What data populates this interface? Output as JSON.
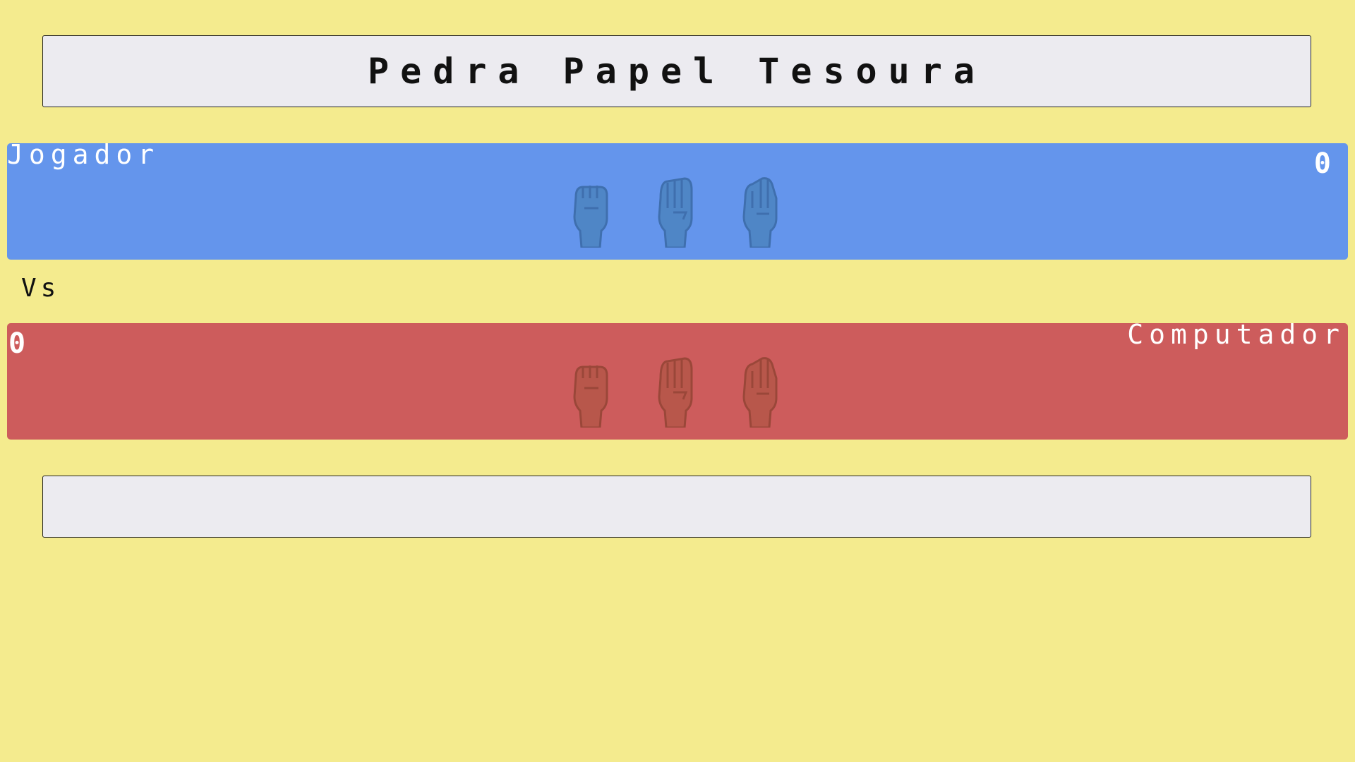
{
  "header": {
    "title": "Pedra Papel Tesoura"
  },
  "player": {
    "label": "Jogador",
    "score": "0",
    "color": "#6495ec",
    "choices": [
      {
        "icon": "rock-hand-icon"
      },
      {
        "icon": "paper-hand-icon"
      },
      {
        "icon": "scissors-hand-icon"
      }
    ]
  },
  "versus": {
    "label": "Vs"
  },
  "computer": {
    "label": "Computador",
    "score": "0",
    "color": "#cd5c5c",
    "choices": [
      {
        "icon": "rock-hand-icon"
      },
      {
        "icon": "paper-hand-icon"
      },
      {
        "icon": "scissors-hand-icon"
      }
    ]
  },
  "result": {
    "text": ""
  },
  "colors": {
    "background": "#f4eb8e",
    "box": "#ecebf0"
  }
}
